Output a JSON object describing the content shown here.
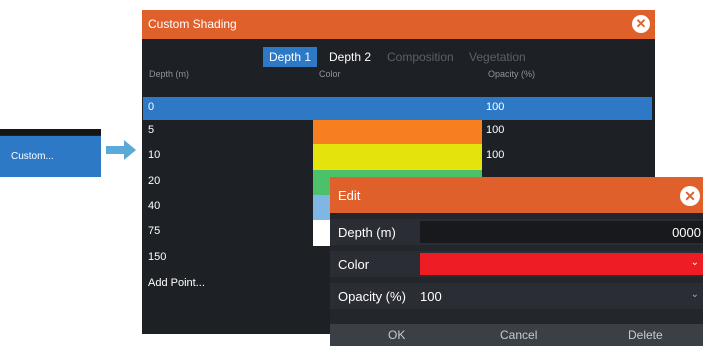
{
  "colors": {
    "accent": "#e0602c",
    "selection": "#2e79c6",
    "dialog_bg": "#1d2025",
    "orange": "#f77f1f",
    "yellow": "#e4e40c",
    "green": "#4cc16a",
    "light_blue": "#7fb6e3",
    "white": "#ffffff",
    "red": "#ee1d24"
  },
  "side_menu": {
    "item_label": "Custom..."
  },
  "dialog": {
    "title": "Custom Shading",
    "tabs": [
      {
        "label": "Depth 1",
        "state": "active"
      },
      {
        "label": "Depth 2",
        "state": "normal"
      },
      {
        "label": "Composition",
        "state": "disabled"
      },
      {
        "label": "Vegetation",
        "state": "disabled"
      }
    ],
    "columns": [
      "Depth (m)",
      "Color",
      "Opacity (%)"
    ],
    "rows": [
      {
        "depth": "0",
        "opacity": "100",
        "selected": true
      },
      {
        "depth": "5",
        "color": "orange",
        "opacity": "100"
      },
      {
        "depth": "10",
        "color": "yellow",
        "opacity": "100"
      },
      {
        "depth": "20",
        "color": "green"
      },
      {
        "depth": "40",
        "color": "light_blue"
      },
      {
        "depth": "75",
        "color": "white"
      },
      {
        "depth": "150"
      }
    ],
    "add_point_label": "Add Point..."
  },
  "edit_dialog": {
    "title": "Edit",
    "depth_label": "Depth (m)",
    "depth_value": "0000",
    "color_label": "Color",
    "color_value": "red",
    "opacity_label": "Opacity (%)",
    "opacity_value": "100",
    "buttons": [
      "OK",
      "Cancel",
      "Delete"
    ]
  }
}
